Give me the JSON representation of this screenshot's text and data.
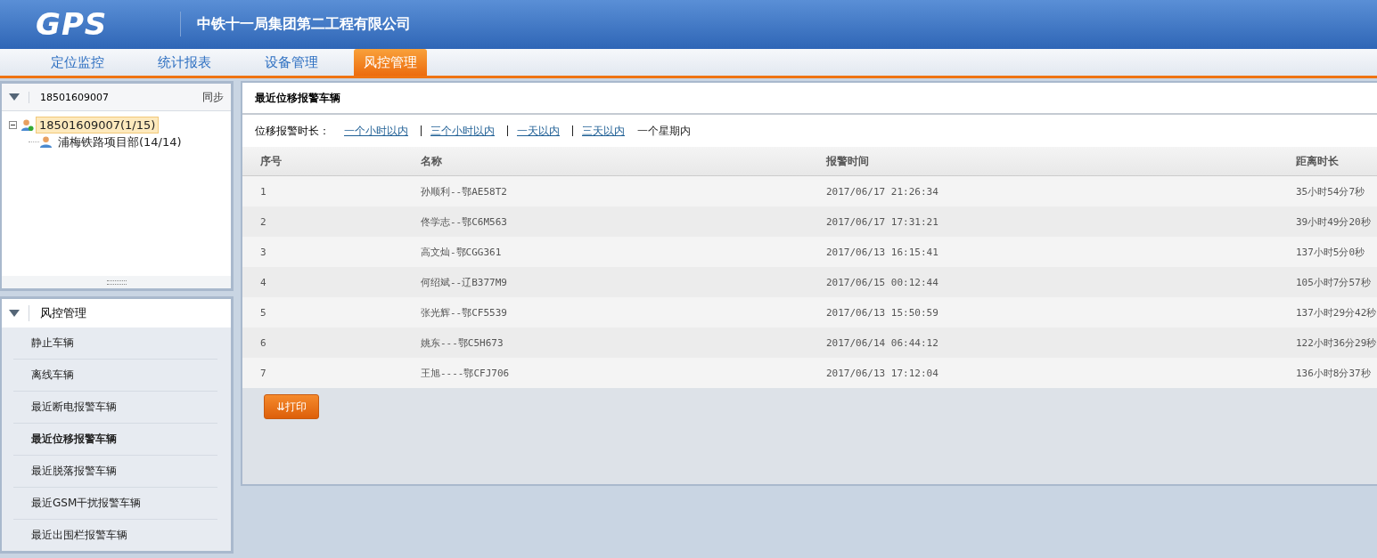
{
  "header": {
    "logo": "GPS",
    "company": "中铁十一局集团第二工程有限公司"
  },
  "nav": [
    {
      "label": "定位监控",
      "selected": false
    },
    {
      "label": "统计报表",
      "selected": false
    },
    {
      "label": "设备管理",
      "selected": false
    },
    {
      "label": "风控管理",
      "selected": true
    }
  ],
  "account_panel": {
    "account": "18501609007",
    "sync": "同步",
    "tree": [
      {
        "label": "18501609007(1/15)",
        "selected": true,
        "expanded": true,
        "children": [
          {
            "label": "浦梅铁路项目部(14/14)",
            "selected": false
          }
        ]
      }
    ]
  },
  "menu_panel": {
    "title": "风控管理",
    "items": [
      {
        "label": "静止车辆",
        "selected": false
      },
      {
        "label": "离线车辆",
        "selected": false
      },
      {
        "label": "最近断电报警车辆",
        "selected": false
      },
      {
        "label": "最近位移报警车辆",
        "selected": true
      },
      {
        "label": "最近脱落报警车辆",
        "selected": false
      },
      {
        "label": "最近GSM干扰报警车辆",
        "selected": false
      },
      {
        "label": "最近出围栏报警车辆",
        "selected": false
      }
    ]
  },
  "content": {
    "title": "最近位移报警车辆",
    "filter_label": "位移报警时长：",
    "periods": [
      {
        "label": "一个小时以内",
        "selected": false
      },
      {
        "label": "三个小时以内",
        "selected": false
      },
      {
        "label": "一天以内",
        "selected": false
      },
      {
        "label": "三天以内",
        "selected": false
      },
      {
        "label": "一个星期内",
        "selected": true
      }
    ],
    "table": {
      "columns": [
        "序号",
        "名称",
        "报警时间",
        "距离时长"
      ],
      "rows": [
        [
          "1",
          "孙顺利--鄂AE58T2",
          "2017/06/17 21:26:34",
          "35小时54分7秒"
        ],
        [
          "2",
          "佟学志--鄂C6M563",
          "2017/06/17 17:31:21",
          "39小时49分20秒"
        ],
        [
          "3",
          "高文灿-鄂CGG361",
          "2017/06/13 16:15:41",
          "137小时5分0秒"
        ],
        [
          "4",
          "何绍斌--辽B377M9",
          "2017/06/15 00:12:44",
          "105小时7分57秒"
        ],
        [
          "5",
          "张光辉--鄂CF5539",
          "2017/06/13 15:50:59",
          "137小时29分42秒"
        ],
        [
          "6",
          "姚东---鄂C5H673",
          "2017/06/14 06:44:12",
          "122小时36分29秒"
        ],
        [
          "7",
          "王旭----鄂CFJ706",
          "2017/06/13 17:12:04",
          "136小时8分37秒"
        ]
      ]
    },
    "print_button": "⇊打印"
  }
}
